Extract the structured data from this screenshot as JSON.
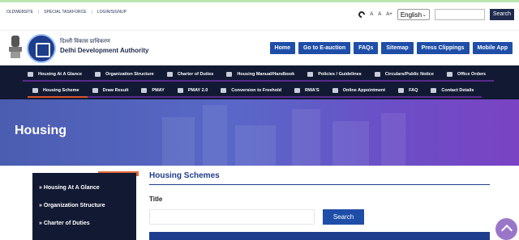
{
  "topbar": {
    "links": [
      "OLDWEBSITE",
      "SPECIAL TASKFORCE",
      "LOGIN/SIGNUP"
    ],
    "font_controls": [
      "A",
      "A",
      "A+"
    ],
    "language": "English",
    "search_button": "Search"
  },
  "header": {
    "org_hindi": "दिल्ली विकास प्राधिकरण",
    "org_name": "Delhi Development Authority",
    "nav": [
      "Home",
      "Go to E-auction",
      "FAQs",
      "Sitemap",
      "Press Clippings",
      "Mobile App"
    ]
  },
  "mainnav": {
    "row1": [
      "Housing At A Glance",
      "Organization Structure",
      "Charter of Duties",
      "Housing Manual/Handbook",
      "Policies / Guidelines",
      "Circulars/Public Notice",
      "Office Orders"
    ],
    "row2": [
      "Housing Scheme",
      "Draw Result",
      "PMAY",
      "PMAY 2.0",
      "Conversion to Freehold",
      "RWA'S",
      "Online Appointment",
      "FAQ",
      "Contact Details"
    ]
  },
  "banner": {
    "title": "Housing"
  },
  "sidebar": {
    "items": [
      "» Housing At A Glance",
      "» Organization Structure",
      "» Charter of Duties"
    ]
  },
  "content": {
    "title": "Housing Schemes",
    "field_label": "Title",
    "search_button": "Search"
  },
  "colors": {
    "nav_bg": "#121a33",
    "primary_blue": "#1e4ea8",
    "accent_orange": "#e2683a",
    "banner_purple": "#6b4fc7"
  }
}
